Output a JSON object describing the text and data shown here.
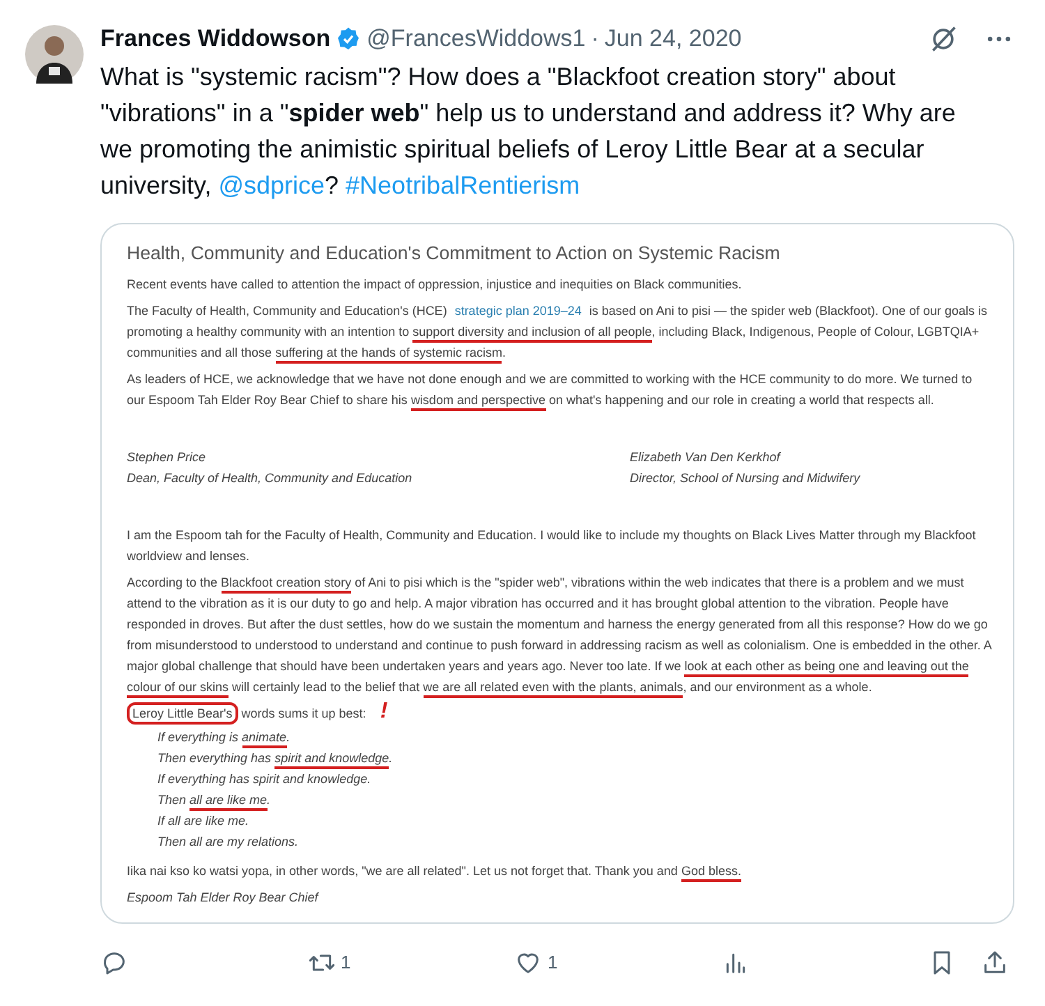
{
  "author": {
    "name": "Frances Widdowson",
    "verified": true,
    "handle": "@FrancesWiddows1",
    "separator": "·",
    "date": "Jun 24, 2020"
  },
  "tweet_text": [
    {
      "text": "What is \"systemic racism\"?  How does a \"Blackfoot creation story\" about \"vibrations\" in a \"",
      "kind": "plain"
    },
    {
      "text": "spider web",
      "kind": "bold"
    },
    {
      "text": "\" help us to understand and address it? Why are we promoting the animistic spiritual beliefs of Leroy Little Bear at a secular university, ",
      "kind": "plain"
    },
    {
      "text": "@sdprice",
      "kind": "mention"
    },
    {
      "text": "? ",
      "kind": "plain"
    },
    {
      "text": "#NeotribalRentierism",
      "kind": "hashtag"
    }
  ],
  "document": {
    "title": "Health, Community and Education's Commitment to Action on Systemic Racism",
    "blocks": [
      {
        "kind": "paragraph",
        "segments": [
          {
            "text": "Recent events have called to attention the impact of oppression, injustice and inequities on Black communities."
          }
        ]
      },
      {
        "kind": "paragraph",
        "segments": [
          {
            "text": "The Faculty of Health, Community and Education's (HCE) "
          },
          {
            "text": "strategic plan 2019–24",
            "kind": "link"
          },
          {
            "text": " is based on Ani to pisi — the spider web (Blackfoot). One of our goals is promoting a healthy community with an intention to "
          },
          {
            "text": "support diversity and inclusion of all people",
            "kind": "underline"
          },
          {
            "text": ", including Black, Indigenous, People of Colour, LGBTQIA+ communities and all those "
          },
          {
            "text": "suffering at the hands of systemic racism",
            "kind": "underline"
          },
          {
            "text": "."
          }
        ]
      },
      {
        "kind": "paragraph",
        "segments": [
          {
            "text": "As leaders of HCE, we acknowledge that we have not done enough and we are committed to working with the HCE community to do more. We turned to our Espoom Tah Elder Roy Bear Chief to share his "
          },
          {
            "text": "wisdom and perspective",
            "kind": "underline"
          },
          {
            "text": " on what's happening and our role in creating a world that respects all."
          }
        ]
      },
      {
        "kind": "signatures",
        "people": [
          {
            "name": "Stephen Price",
            "role": "Dean, Faculty of Health, Community and Education"
          },
          {
            "name": "Elizabeth Van Den Kerkhof",
            "role": "Director, School of Nursing and Midwifery"
          }
        ]
      },
      {
        "kind": "paragraph",
        "segments": [
          {
            "text": "I am the Espoom tah for the Faculty of Health, Community and Education. I would like to include my thoughts on Black Lives Matter through my Blackfoot worldview and lenses."
          }
        ]
      },
      {
        "kind": "paragraph",
        "segments": [
          {
            "text": "According to the "
          },
          {
            "text": "Blackfoot creation story",
            "kind": "underline"
          },
          {
            "text": " of Ani to pisi which is the \"spider web\", vibrations within the web indicates that there is a problem and we must attend to the vibration as it is our duty to go and help. A major vibration has occurred and it has brought global attention to the vibration. People have responded in droves. But after the dust settles, how do we sustain the momentum and harness the energy generated from all this response? How do we go from misunderstood to understood to understand and continue to push forward in addressing racism as well as colonialism. One is embedded in the other. A major global challenge that should have been undertaken years and years ago. Never too late. If we "
          },
          {
            "text": "look at each other as being one and leaving out the colour of our skins",
            "kind": "underline"
          },
          {
            "text": " will certainly lead to the belief that "
          },
          {
            "text": "we are all related even with the plants, animals",
            "kind": "underline"
          },
          {
            "text": ", and our environment as a whole."
          }
        ]
      },
      {
        "kind": "paragraph",
        "segments": [
          {
            "text": "Leroy Little Bear's",
            "kind": "circle"
          },
          {
            "text": " words sums it up best:"
          },
          {
            "text": "!",
            "kind": "annotation"
          }
        ]
      },
      {
        "kind": "poem",
        "lines": [
          {
            "segments": [
              {
                "text": "If everything is "
              },
              {
                "text": "animate",
                "kind": "underline"
              },
              {
                "text": "."
              }
            ]
          },
          {
            "segments": [
              {
                "text": "Then everything has "
              },
              {
                "text": "spirit and knowledge",
                "kind": "underline"
              },
              {
                "text": "."
              }
            ]
          },
          {
            "segments": [
              {
                "text": "If everything has spirit and knowledge."
              }
            ]
          },
          {
            "segments": [
              {
                "text": "Then "
              },
              {
                "text": "all are like me",
                "kind": "underline"
              },
              {
                "text": "."
              }
            ]
          },
          {
            "segments": [
              {
                "text": "If all are like me."
              }
            ]
          },
          {
            "segments": [
              {
                "text": "Then all are my relations."
              }
            ]
          }
        ]
      },
      {
        "kind": "paragraph",
        "segments": [
          {
            "text": "Iika nai kso ko watsi yopa, in other words, \"we are all related\". Let us not forget that. Thank you and "
          },
          {
            "text": "God bless.",
            "kind": "underline"
          }
        ]
      },
      {
        "kind": "closing",
        "segments": [
          {
            "text": "Espoom Tah Elder Roy Bear Chief"
          }
        ]
      }
    ]
  },
  "actions": [
    {
      "kind": "reply"
    },
    {
      "kind": "retweet",
      "count": "1"
    },
    {
      "kind": "like",
      "count": "1"
    },
    {
      "kind": "views"
    },
    {
      "kind": "bookmark"
    },
    {
      "kind": "share"
    }
  ]
}
